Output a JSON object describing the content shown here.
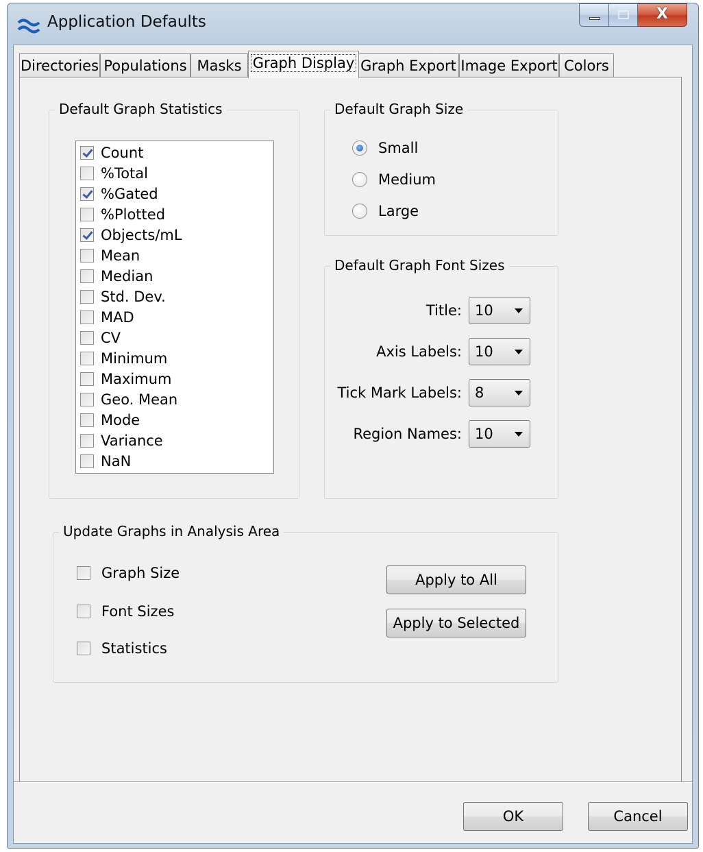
{
  "window": {
    "title": "Application Defaults",
    "close_glyph": "X"
  },
  "tabs": [
    {
      "label": "Directories"
    },
    {
      "label": "Populations"
    },
    {
      "label": "Masks"
    },
    {
      "label": "Graph Display"
    },
    {
      "label": "Graph Export"
    },
    {
      "label": "Image Export"
    },
    {
      "label": "Colors"
    }
  ],
  "active_tab": "Graph Display",
  "statistics": {
    "title": "Default Graph Statistics",
    "items": [
      {
        "label": "Count",
        "checked": true
      },
      {
        "label": "%Total",
        "checked": false
      },
      {
        "label": "%Gated",
        "checked": true
      },
      {
        "label": "%Plotted",
        "checked": false
      },
      {
        "label": "Objects/mL",
        "checked": true
      },
      {
        "label": "Mean",
        "checked": false
      },
      {
        "label": "Median",
        "checked": false
      },
      {
        "label": "Std. Dev.",
        "checked": false
      },
      {
        "label": "MAD",
        "checked": false
      },
      {
        "label": "CV",
        "checked": false
      },
      {
        "label": "Minimum",
        "checked": false
      },
      {
        "label": "Maximum",
        "checked": false
      },
      {
        "label": "Geo. Mean",
        "checked": false
      },
      {
        "label": "Mode",
        "checked": false
      },
      {
        "label": "Variance",
        "checked": false
      },
      {
        "label": "NaN",
        "checked": false
      }
    ]
  },
  "graph_size": {
    "title": "Default Graph Size",
    "options": [
      {
        "label": "Small",
        "selected": true
      },
      {
        "label": "Medium",
        "selected": false
      },
      {
        "label": "Large",
        "selected": false
      }
    ]
  },
  "font_sizes": {
    "title": "Default Graph Font Sizes",
    "rows": [
      {
        "label": "Title:",
        "value": "10"
      },
      {
        "label": "Axis Labels:",
        "value": "10"
      },
      {
        "label": "Tick Mark Labels:",
        "value": "8"
      },
      {
        "label": "Region Names:",
        "value": "10"
      }
    ]
  },
  "update": {
    "title": "Update Graphs in Analysis Area",
    "checks": [
      {
        "label": "Graph Size",
        "checked": false
      },
      {
        "label": "Font Sizes",
        "checked": false
      },
      {
        "label": "Statistics",
        "checked": false
      }
    ],
    "apply_all": "Apply to All",
    "apply_selected": "Apply to Selected"
  },
  "footer": {
    "ok": "OK",
    "cancel": "Cancel"
  },
  "colors": {
    "checkmark": "#3a5fa8",
    "radio_dot": "#1f5fa6",
    "close_button": "#c23a1e"
  }
}
